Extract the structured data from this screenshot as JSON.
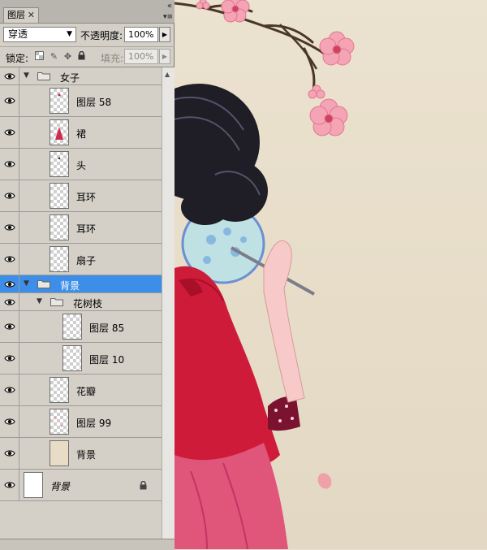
{
  "panel": {
    "tab_label": "图层",
    "close_glyph": "✕",
    "blend_mode": "穿透",
    "opacity_label": "不透明度:",
    "opacity_value": "100%",
    "lock_label": "锁定:",
    "fill_label": "填充:",
    "fill_value": "100%"
  },
  "layers": [
    {
      "name": "女子",
      "kind": "group",
      "expanded": true,
      "depth": 0
    },
    {
      "name": "图层 58",
      "kind": "layer",
      "depth": 1,
      "thumb": "dot-red"
    },
    {
      "name": "裙",
      "kind": "layer",
      "depth": 1,
      "thumb": "skirt"
    },
    {
      "name": "头",
      "kind": "layer",
      "depth": 1,
      "thumb": "dot-dark"
    },
    {
      "name": "耳环",
      "kind": "layer",
      "depth": 1,
      "thumb": "empty"
    },
    {
      "name": "耳环",
      "kind": "layer",
      "depth": 1,
      "thumb": "empty"
    },
    {
      "name": "扇子",
      "kind": "layer",
      "depth": 1,
      "thumb": "empty"
    },
    {
      "name": "背景",
      "kind": "group",
      "expanded": true,
      "depth": 0,
      "selected": true
    },
    {
      "name": "花树枝",
      "kind": "group",
      "expanded": true,
      "depth": 1
    },
    {
      "name": "图层 85",
      "kind": "layer",
      "depth": 2,
      "thumb": "empty"
    },
    {
      "name": "图层 10",
      "kind": "layer",
      "depth": 2,
      "thumb": "empty"
    },
    {
      "name": "花瓣",
      "kind": "layer",
      "depth": 1,
      "thumb": "empty"
    },
    {
      "name": "图层 99",
      "kind": "layer",
      "depth": 1,
      "thumb": "petals"
    },
    {
      "name": "背景",
      "kind": "layer",
      "depth": 1,
      "thumb": "beige"
    },
    {
      "name": "背景",
      "kind": "base",
      "depth": 0,
      "thumb": "white",
      "locked": true
    }
  ],
  "icons": {
    "visibility": "eye-icon",
    "group": "folder-icon",
    "lock": "lock-icon",
    "expand": "triangle-down-icon"
  },
  "colors": {
    "selection": "#3d8ee8",
    "panel_bg": "#d4d0c8",
    "canvas_bg": "#e8dfcb",
    "dress_red": "#c8102e",
    "blossom_pink": "#f2a0b0"
  }
}
